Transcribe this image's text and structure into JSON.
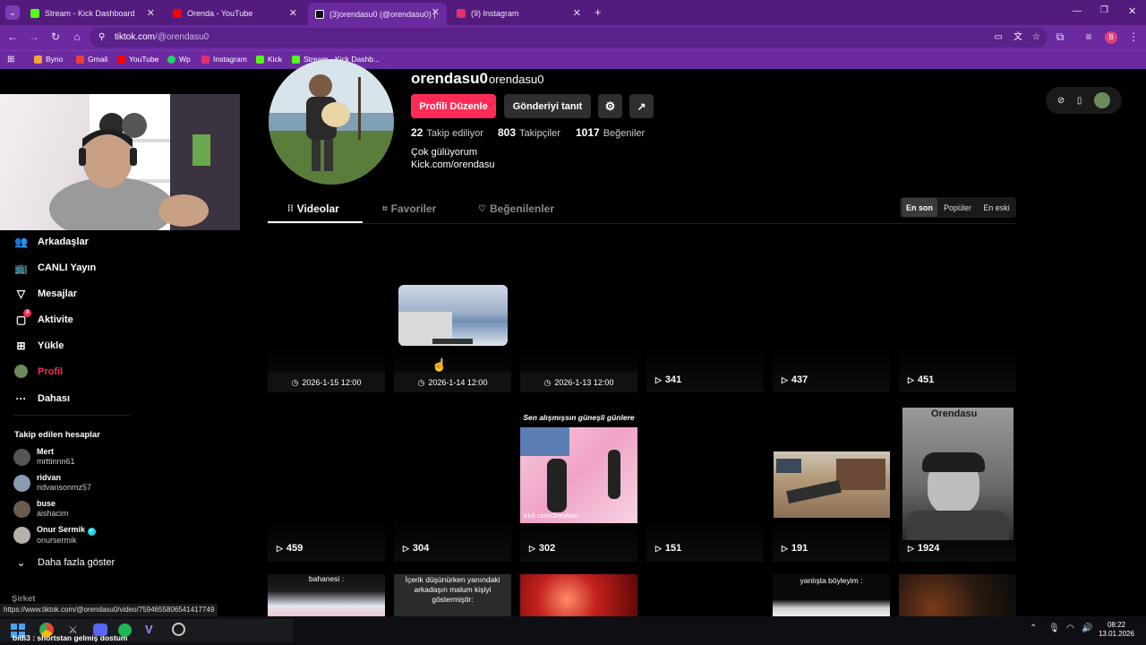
{
  "browser": {
    "tabs": [
      {
        "label": "Stream - Kick Dashboard",
        "color": "#53fc18"
      },
      {
        "label": "Orenda - YouTube",
        "color": "#ff0000"
      },
      {
        "label": "(3)orendasu0 (@orendasu0) | T",
        "color": "#111111"
      },
      {
        "label": "(9) Instagram",
        "color": "#e1306c"
      }
    ],
    "new_tab": "+",
    "url_host": "tiktok.com",
    "url_path": "/@orendasu0",
    "bookmarks": [
      {
        "label": "Byno",
        "color": "#f4a33b"
      },
      {
        "label": "Gmail",
        "color": "#ea4335"
      },
      {
        "label": "YouTube",
        "color": "#ff0000"
      },
      {
        "label": "Wp",
        "color": "#25d366"
      },
      {
        "label": "Instagram",
        "color": "#e1306c"
      },
      {
        "label": "Kick",
        "color": "#53fc18"
      },
      {
        "label": "Stream - Kick Dashb...",
        "color": "#53fc18"
      }
    ],
    "profile_initial": "B"
  },
  "sidebar": {
    "nav": [
      {
        "label": "Arkadaşlar",
        "icon": "friends-icon"
      },
      {
        "label": "CANLI Yayın",
        "icon": "live-icon"
      },
      {
        "label": "Mesajlar",
        "icon": "messages-icon"
      },
      {
        "label": "Aktivite",
        "icon": "activity-icon",
        "badge": "3"
      },
      {
        "label": "Yükle",
        "icon": "upload-icon"
      },
      {
        "label": "Profil",
        "icon": "profile-icon"
      },
      {
        "label": "Dahası",
        "icon": "more-icon"
      }
    ],
    "following_title": "Takip edilen hesaplar",
    "following": [
      {
        "name": "Mert",
        "username": "mrttinnn61"
      },
      {
        "name": "ridvan",
        "username": "ridvansonmz57"
      },
      {
        "name": "buse",
        "username": "aishacim"
      },
      {
        "name": "Onur Sermik",
        "username": "onursermik"
      }
    ],
    "show_more": "Daha fazla göster",
    "company": "Şirket"
  },
  "profile": {
    "display_name": "orendasu0",
    "username": "orendasu0",
    "edit_button": "Profili Düzenle",
    "promote_button": "Gönderiyi tanıt",
    "stats": [
      {
        "value": "22",
        "label": "Takip ediliyor"
      },
      {
        "value": "803",
        "label": "Takipçiler"
      },
      {
        "value": "1017",
        "label": "Beğeniler"
      }
    ],
    "bio": "Çok gülüyorum",
    "link": "Kick.com/orendasu",
    "tabs": [
      "Videolar",
      "Favoriler",
      "Beğenilenler"
    ],
    "sort": [
      "En son",
      "Popüler",
      "En eski"
    ]
  },
  "videos": {
    "row1": [
      {
        "date": "2026-1-15 12:00"
      },
      {
        "date": "2026-1-14 12:00"
      },
      {
        "date": "2026-1-13 12:00"
      },
      {
        "views": "341"
      },
      {
        "views": "437"
      },
      {
        "views": "451"
      }
    ],
    "row2": [
      {
        "views": "459"
      },
      {
        "views": "304"
      },
      {
        "views": "302",
        "caption": "Sen alışmışsın güneşli günlere"
      },
      {
        "views": "151"
      },
      {
        "views": "191"
      },
      {
        "views": "1924",
        "watermark": "Orendasu"
      }
    ],
    "row2_watermark_link": "Kick.com/Orendasu",
    "row3_captions": [
      "bahanesi :",
      "İçerik düşünürken yanındaki arkadaşın malum kişiyi göstermiştir:",
      "",
      "",
      "yanlışta böyleyim :",
      ""
    ]
  },
  "status_url": "https://www.tiktok.com/@orendasu0/video/7594655806541417749",
  "taskbar": {
    "now_playing": "bidi3 : shortstan gelmiş dostum",
    "time": "08:22",
    "date": "13.01.2026"
  }
}
